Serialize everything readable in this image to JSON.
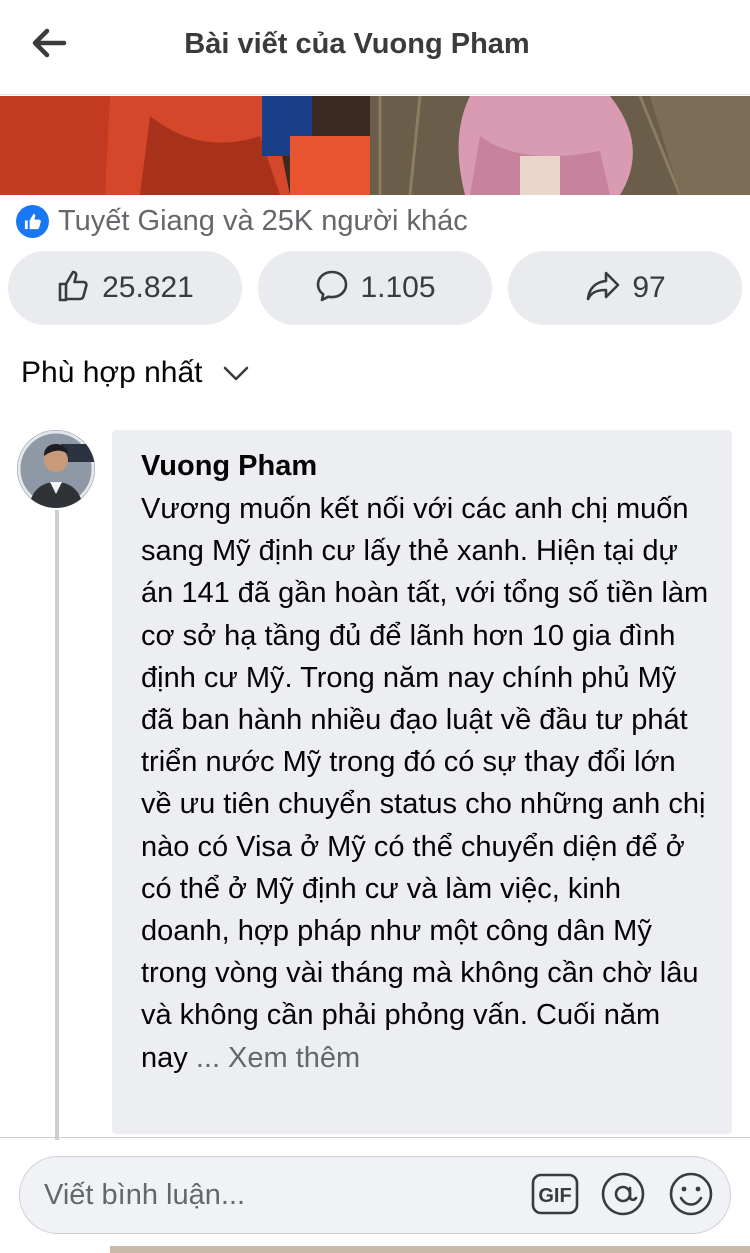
{
  "header": {
    "title": "Bài viết của Vuong Pham",
    "back_icon": "arrow-left-icon"
  },
  "reactions": {
    "summary": "Tuyết Giang và 25K người khác",
    "badge_icon": "thumbs-up-icon",
    "badge_color": "#1877f2"
  },
  "actions": {
    "likes": "25.821",
    "comments": "1.105",
    "shares": "97"
  },
  "sort": {
    "label": "Phù hợp nhất",
    "icon": "chevron-down-icon"
  },
  "comment": {
    "author": "Vuong Pham",
    "text": "Vương muốn kết nối với các anh chị muốn sang Mỹ định cư lấy thẻ xanh. Hiện tại dự án 141 đã gần hoàn tất, với tổng số tiền làm cơ sở hạ tầng đủ để lãnh hơn 10 gia đình định cư Mỹ. Trong năm nay chính phủ Mỹ đã ban hành nhiều đạo luật về đầu tư phát triển nước Mỹ trong đó có sự thay đổi lớn về ưu tiên chuyển status cho những anh chị nào có Visa ở Mỹ có thể chuyển diện để ở có thể ở Mỹ định cư và làm việc, kinh doanh, hợp pháp như một công dân Mỹ trong vòng vài tháng mà không cần chờ lâu và không cần phải phỏng vấn. Cuối năm nay",
    "see_more": "... Xem thêm"
  },
  "composer": {
    "placeholder": "Viết bình luận...",
    "gif_label": "GIF"
  },
  "colors": {
    "pill_bg": "#e9ebee",
    "bubble_bg": "#eceef1",
    "muted_text": "#65676b"
  }
}
